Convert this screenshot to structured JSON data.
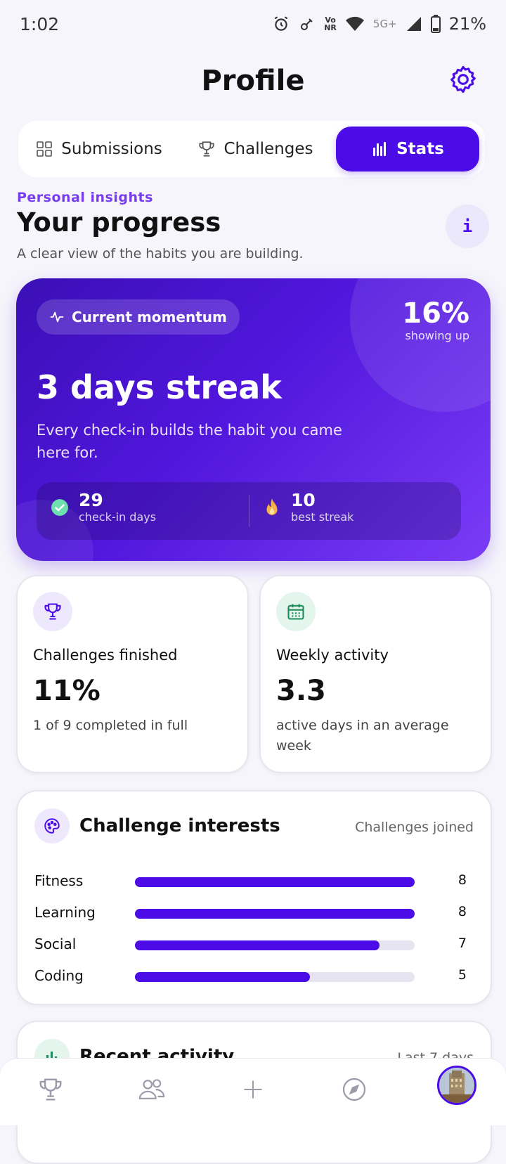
{
  "status_bar": {
    "time": "1:02",
    "network_small_1": "Vo",
    "network_small_2": "NR",
    "network_5g": "5G+",
    "battery": "21%"
  },
  "header": {
    "title": "Profile"
  },
  "tabs": [
    {
      "label": "Submissions",
      "icon": "grid-icon",
      "active": false
    },
    {
      "label": "Challenges",
      "icon": "trophy-icon",
      "active": false
    },
    {
      "label": "Stats",
      "icon": "bar-chart-icon",
      "active": true
    }
  ],
  "insights": {
    "eyebrow": "Personal insights",
    "title": "Your progress",
    "subtitle": "A clear view of the habits you are building.",
    "info_label": "i"
  },
  "momentum": {
    "pill_label": "Current momentum",
    "percent": "16%",
    "percent_label": "showing up",
    "streak_title": "3 days streak",
    "message": "Every check-in builds the habit you came here for.",
    "checkin_days_value": "29",
    "checkin_days_label": "check-in days",
    "best_streak_value": "10",
    "best_streak_label": "best streak"
  },
  "challenges_card": {
    "title": "Challenges finished",
    "value": "11%",
    "note": "1 of 9 completed in full"
  },
  "weekly_card": {
    "title": "Weekly activity",
    "value": "3.3",
    "note": "active days in an average week"
  },
  "interests": {
    "title": "Challenge interests",
    "meta": "Challenges joined",
    "max": 8,
    "items": [
      {
        "label": "Fitness",
        "value": 8,
        "count": "8"
      },
      {
        "label": "Learning",
        "value": 8,
        "count": "8"
      },
      {
        "label": "Social",
        "value": 7,
        "count": "7"
      },
      {
        "label": "Coding",
        "value": 5,
        "count": "5"
      }
    ]
  },
  "recent": {
    "title": "Recent activity",
    "meta": "Last 7 days"
  },
  "bottom_nav": [
    {
      "name": "trophy-icon"
    },
    {
      "name": "people-icon"
    },
    {
      "name": "plus-icon"
    },
    {
      "name": "compass-icon"
    },
    {
      "name": "avatar"
    }
  ],
  "colors": {
    "accent": "#4b0ce8",
    "accent_light": "#7a3cf0",
    "bar_track": "#e6e4f0",
    "success": "#6ee0b0",
    "flame": "#f6b24a"
  }
}
